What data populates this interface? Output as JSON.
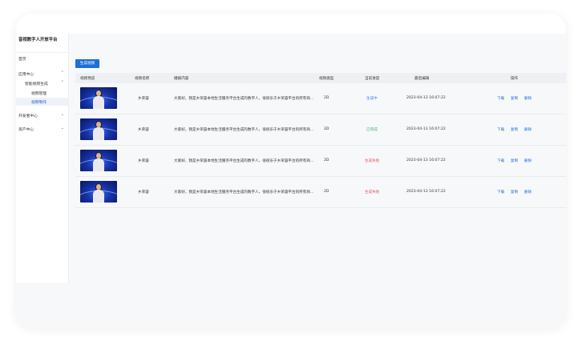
{
  "app": {
    "title": "音视数字人开放平台"
  },
  "sidebar": {
    "items": [
      {
        "label": "首页",
        "chevron": ""
      },
      {
        "label": "应用中心",
        "chevron": "⌃"
      },
      {
        "label": "智能视频生成",
        "chevron": "⌃"
      },
      {
        "label": "视频管理",
        "chevron": ""
      },
      {
        "label": "视频制作",
        "chevron": ""
      },
      {
        "label": "开发者中心",
        "chevron": "⌄"
      },
      {
        "label": "资产中心",
        "chevron": "⌄"
      }
    ]
  },
  "toolbar": {
    "generate_label": "生成视频"
  },
  "table": {
    "headers": [
      "视频预览",
      "视频名称",
      "播报内容",
      "视频类型",
      "当前进度",
      "最后编辑",
      "操作"
    ],
    "rows": [
      {
        "name": "乡荣容",
        "content": "大家好，我是乡荣容本地生活服务平台生成的数字人，很很乐于乡荣容平台的所有商...",
        "type": "2D",
        "status": "生成中",
        "status_color": "#3b82f6",
        "edited": "2023-04-13 16:07:22",
        "actions": [
          "下载",
          "复制",
          "删除"
        ]
      },
      {
        "name": "乡荣容",
        "content": "大家好，我是乡荣容本地生活服务平台生成的数字人，很很乐于乡荣容平台的所有商...",
        "type": "2D",
        "status": "已完成",
        "status_color": "#3cb371",
        "edited": "2023-04-13 16:07:22",
        "actions": [
          "下载",
          "复制",
          "删除"
        ]
      },
      {
        "name": "乡荣容",
        "content": "大家好，我是乡荣容本地生活服务平台生成的数字人，很很乐于乡荣容平台的所有商...",
        "type": "2D",
        "status": "生成失败",
        "status_color": "#e25b5b",
        "edited": "2023-04-13 16:07:22",
        "actions": [
          "下载",
          "复制",
          "删除"
        ]
      },
      {
        "name": "乡荣容",
        "content": "大家好，我是乡荣容本地生活服务平台生成的数字人，很很乐于乡荣容平台的所有商...",
        "type": "2D",
        "status": "生成失败",
        "status_color": "#e25b5b",
        "edited": "2023-04-13 16:07:22",
        "actions": [
          "下载",
          "复制",
          "删除"
        ]
      }
    ]
  },
  "icons": {
    "thumbnail": "digital-human-thumbnail",
    "chevron_up": "chevron-up-icon",
    "chevron_down": "chevron-down-icon"
  }
}
